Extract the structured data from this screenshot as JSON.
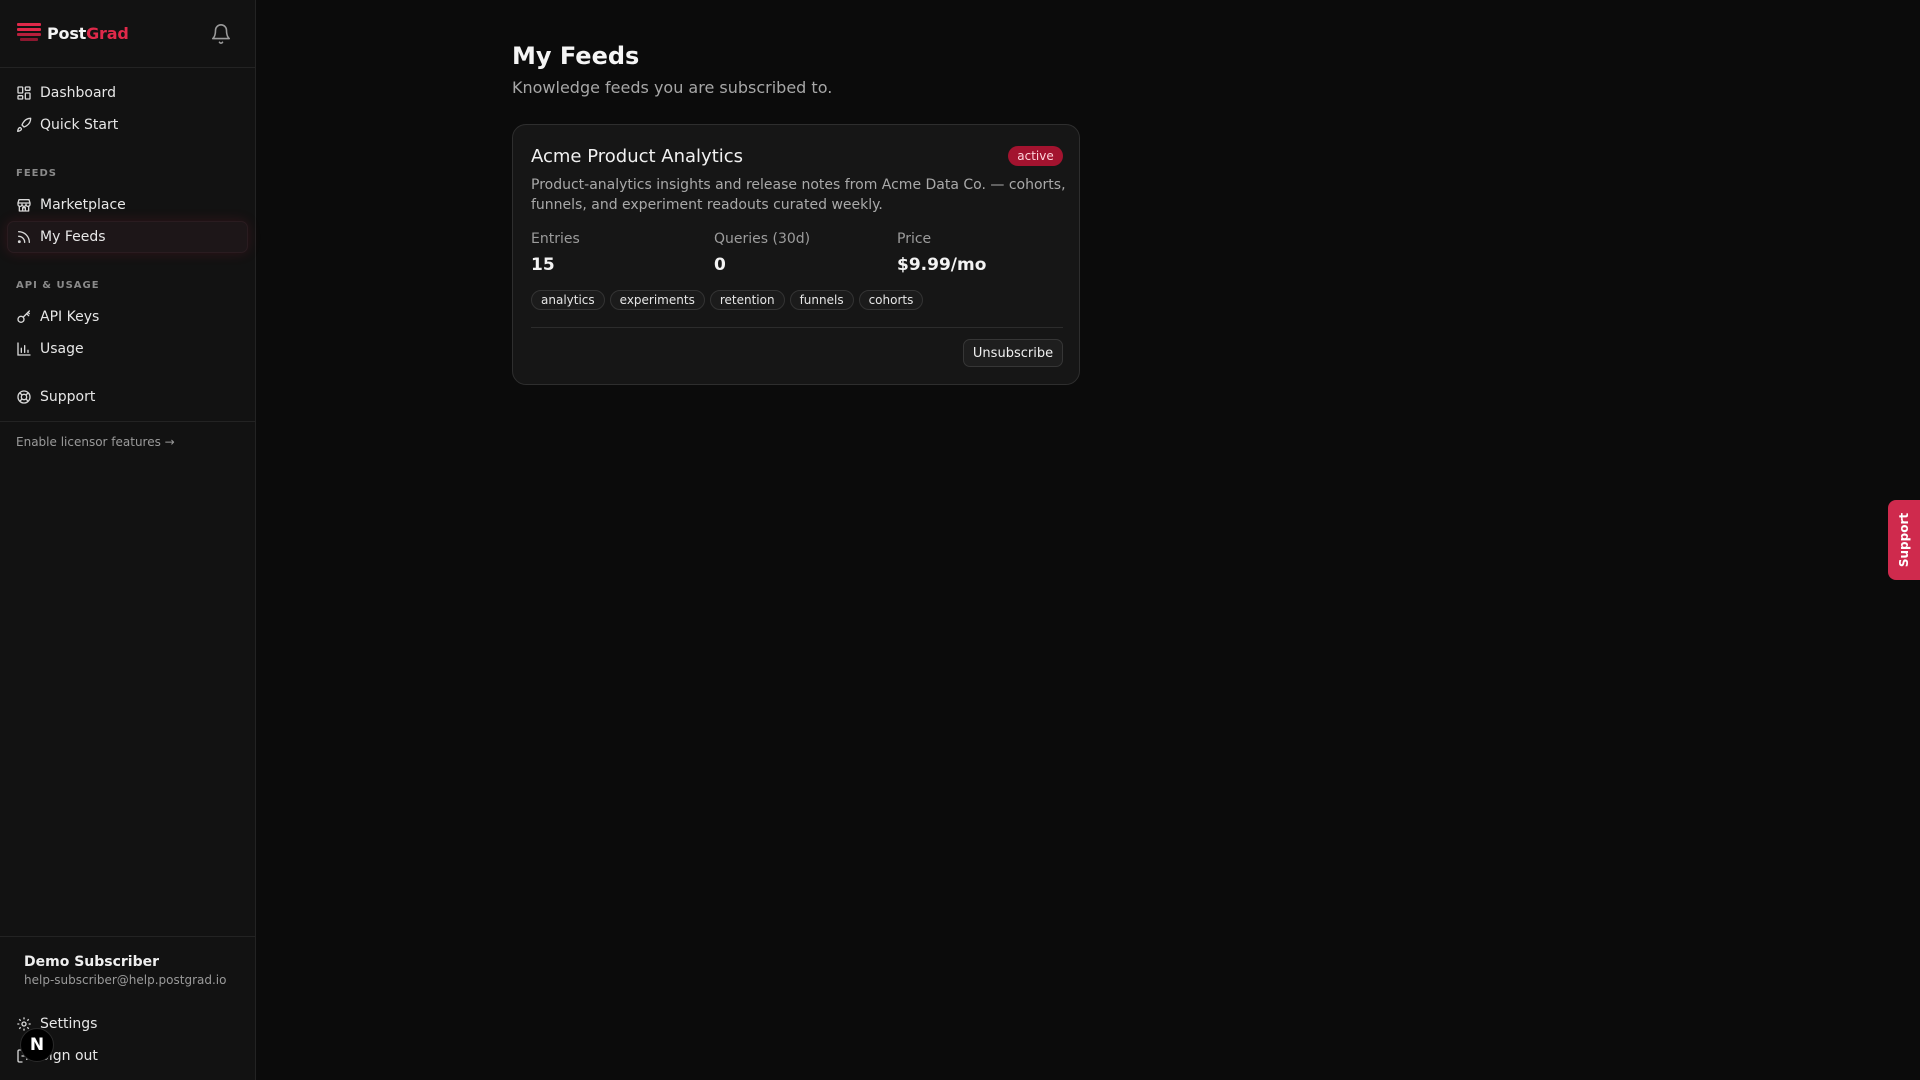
{
  "brand": {
    "name_primary": "Post",
    "name_accent": "Grad"
  },
  "sidebar": {
    "items_top": [
      {
        "label": "Dashboard",
        "icon": "dashboard-icon"
      },
      {
        "label": "Quick Start",
        "icon": "rocket-icon"
      }
    ],
    "section_feeds": "FEEDS",
    "items_feeds": [
      {
        "label": "Marketplace",
        "icon": "store-icon"
      },
      {
        "label": "My Feeds",
        "icon": "rss-icon",
        "active": true
      }
    ],
    "section_api": "API & USAGE",
    "items_api": [
      {
        "label": "API Keys",
        "icon": "key-icon"
      },
      {
        "label": "Usage",
        "icon": "bar-chart-icon"
      }
    ],
    "support_label": "Support",
    "licensor_link": "Enable licensor features →",
    "user": {
      "name": "Demo Subscriber",
      "email": "help-subscriber@help.postgrad.io"
    },
    "settings_label": "Settings",
    "signout_label": "Sign out",
    "badge_letter": "N"
  },
  "main": {
    "title": "My Feeds",
    "subtitle": "Knowledge feeds you are subscribed to.",
    "feeds": [
      {
        "title": "Acme Product Analytics",
        "status": "active",
        "description": "Product-analytics insights and release notes from Acme Data Co. — cohorts, funnels, and experiment readouts curated weekly.",
        "stats": [
          {
            "label": "Entries",
            "value": "15"
          },
          {
            "label": "Queries (30d)",
            "value": "0"
          },
          {
            "label": "Price",
            "value": "$9.99/mo"
          }
        ],
        "tags": [
          "analytics",
          "experiments",
          "retention",
          "funnels",
          "cohorts"
        ],
        "action_label": "Unsubscribe"
      }
    ]
  },
  "support_tab_label": "Support",
  "colors": {
    "accent": "#e0294a",
    "background": "#0b0b0b",
    "sidebar": "#121212",
    "card": "#161616"
  }
}
